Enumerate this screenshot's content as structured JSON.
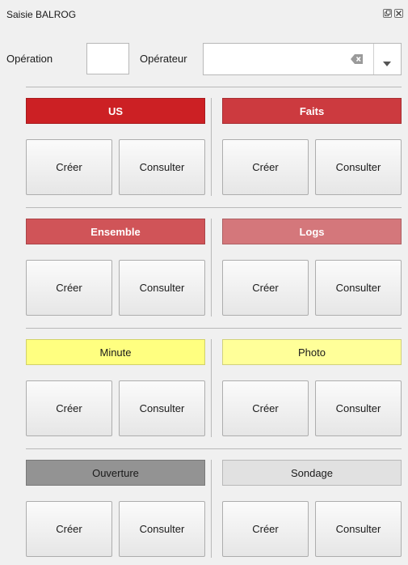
{
  "window": {
    "title": "Saisie BALROG"
  },
  "toolbar": {
    "operation_label": "Opération",
    "operation_value": "",
    "operateur_label": "Opérateur",
    "operateur_value": ""
  },
  "sections": [
    {
      "name": "US",
      "color": "#cc2024",
      "text_color": "#ffffff",
      "bold": true,
      "create_label": "Créer",
      "consult_label": "Consulter"
    },
    {
      "name": "Faits",
      "color": "#cc3a3f",
      "text_color": "#ffffff",
      "bold": true,
      "create_label": "Créer",
      "consult_label": "Consulter"
    },
    {
      "name": "Ensemble",
      "color": "#d05458",
      "text_color": "#ffffff",
      "bold": true,
      "create_label": "Créer",
      "consult_label": "Consulter"
    },
    {
      "name": "Logs",
      "color": "#d4777b",
      "text_color": "#ffffff",
      "bold": true,
      "create_label": "Créer",
      "consult_label": "Consulter"
    },
    {
      "name": "Minute",
      "color": "#ffff80",
      "text_color": "#1a1a1a",
      "bold": false,
      "create_label": "Créer",
      "consult_label": "Consulter"
    },
    {
      "name": "Photo",
      "color": "#ffff99",
      "text_color": "#1a1a1a",
      "bold": false,
      "create_label": "Créer",
      "consult_label": "Consulter"
    },
    {
      "name": "Ouverture",
      "color": "#939393",
      "text_color": "#1a1a1a",
      "bold": false,
      "create_label": "Créer",
      "consult_label": "Consulter"
    },
    {
      "name": "Sondage",
      "color": "#e1e1e1",
      "text_color": "#1a1a1a",
      "bold": false,
      "create_label": "Créer",
      "consult_label": "Consulter"
    }
  ],
  "icons": {
    "float": "float-icon",
    "close": "close-icon",
    "clear": "clear-field-icon",
    "dropdown": "chevron-down-icon"
  }
}
